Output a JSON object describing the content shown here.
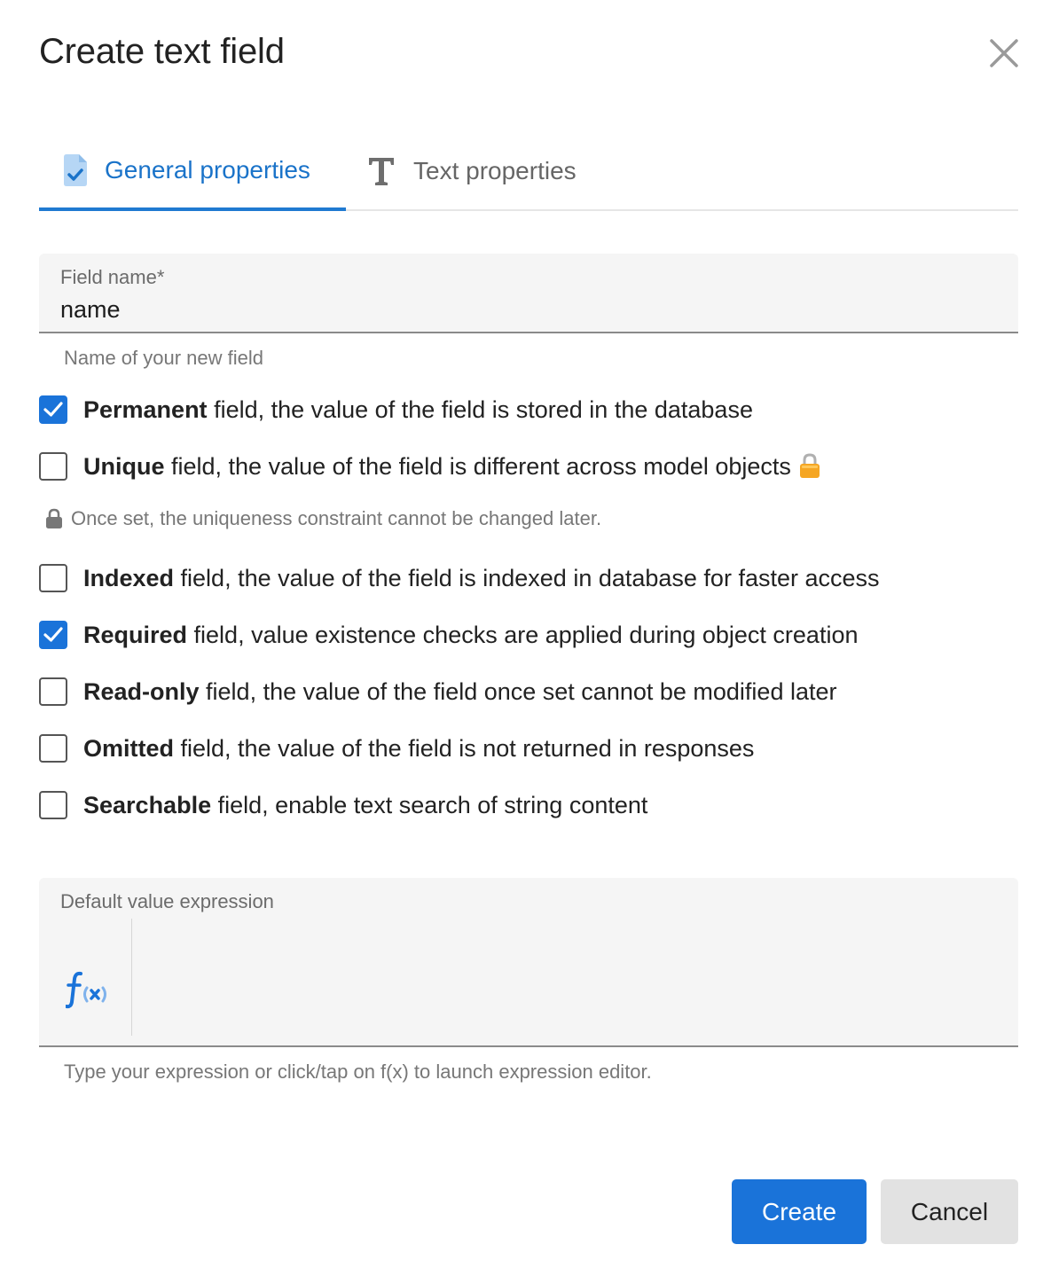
{
  "dialog": {
    "title": "Create text field"
  },
  "tabs": [
    {
      "label": "General properties",
      "icon": "document-check-icon",
      "active": true
    },
    {
      "label": "Text properties",
      "icon": "text-t-icon",
      "active": false
    }
  ],
  "field_name": {
    "label": "Field name",
    "required_mark": "*",
    "value": "name",
    "helper": "Name of your new field"
  },
  "options": [
    {
      "bold": "Permanent",
      "rest": " field, the value of the field is stored in the database",
      "checked": true
    },
    {
      "bold": "Unique",
      "rest": " field, the value of the field is different across model objects",
      "checked": false
    },
    {
      "bold": "Indexed",
      "rest": " field, the value of the field is indexed in database for faster access",
      "checked": false
    },
    {
      "bold": "Required",
      "rest": " field, value existence checks are applied during object creation",
      "checked": true
    },
    {
      "bold": "Read-only",
      "rest": " field, the value of the field once set cannot be modified later",
      "checked": false
    },
    {
      "bold": "Omitted",
      "rest": " field, the value of the field is not returned in responses",
      "checked": false
    },
    {
      "bold": "Searchable",
      "rest": " field, enable text search of string content",
      "checked": false
    }
  ],
  "unique_note": "Once set, the uniqueness constraint cannot be changed later.",
  "default_value": {
    "label": "Default value expression",
    "helper": "Type your expression or click/tap on f(x) to launch expression editor."
  },
  "buttons": {
    "create": "Create",
    "cancel": "Cancel"
  },
  "colors": {
    "accent": "#1a73d9",
    "lock_orange": "#f5a623",
    "muted": "#777777"
  }
}
